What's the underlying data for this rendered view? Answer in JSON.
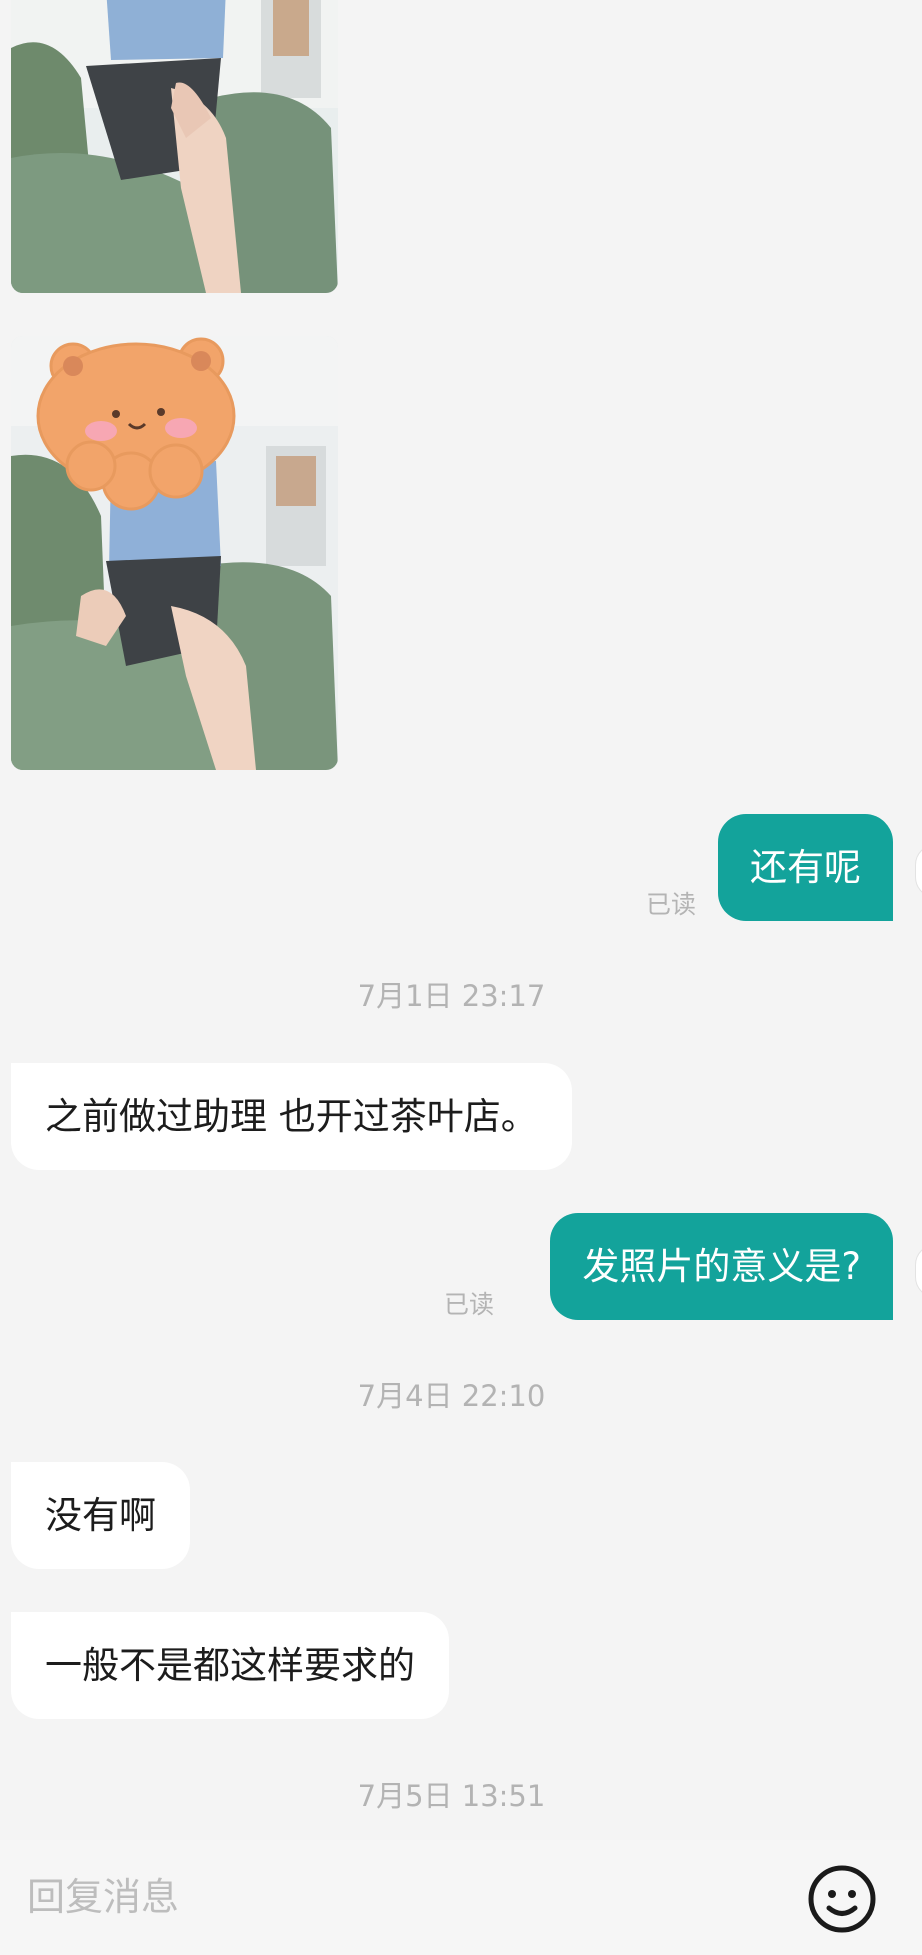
{
  "messages": [
    {
      "id": "out_1",
      "direction": "outgoing",
      "text": "还有呢",
      "status": "已读"
    },
    {
      "id": "ts_1",
      "type": "timestamp",
      "text": "7月1日 23:17"
    },
    {
      "id": "in_1",
      "direction": "incoming",
      "text": "之前做过助理 也开过茶叶店。"
    },
    {
      "id": "out_2",
      "direction": "outgoing",
      "text": "发照片的意义是?",
      "status": "已读"
    },
    {
      "id": "ts_2",
      "type": "timestamp",
      "text": "7月4日 22:10"
    },
    {
      "id": "in_2",
      "direction": "incoming",
      "text": "没有啊"
    },
    {
      "id": "in_3",
      "direction": "incoming",
      "text": "一般不是都这样要求的"
    },
    {
      "id": "ts_3",
      "type": "timestamp",
      "text": "7月5日 13:51"
    }
  ],
  "chat": {
    "out_1": {
      "text": "还有呢",
      "status": "已读"
    },
    "ts_1": "7月1日 23:17",
    "in_1": "之前做过助理 也开过茶叶店。",
    "out_2": {
      "text": "发照片的意义是?",
      "status": "已读"
    },
    "ts_2": "7月4日 22:10",
    "in_2": "没有啊",
    "in_3": "一般不是都这样要求的",
    "ts_3": "7月5日 13:51"
  },
  "input_bar": {
    "placeholder": "回复消息",
    "emoji_icon": "smiley-face-icon"
  },
  "colors": {
    "outgoing_bubble": "#13a39b",
    "incoming_bubble": "#ffffff",
    "background": "#f4f4f4",
    "meta_text": "#b3b3b3"
  }
}
